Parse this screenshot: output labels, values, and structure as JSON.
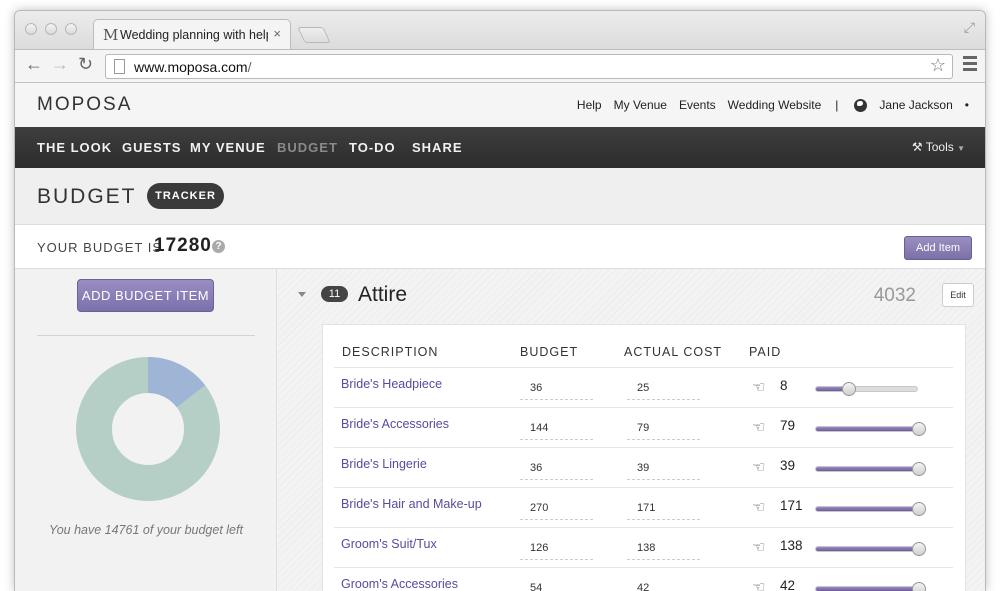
{
  "browser": {
    "tab_title": "Wedding planning with helpful",
    "tab_favicon": "M",
    "tab_close": "×",
    "url_host": "www.moposa.com",
    "url_path": "/",
    "icons": [
      "back-arrow-icon",
      "forward-arrow-icon",
      "reload-icon",
      "page-icon",
      "star-icon",
      "menu-icon",
      "close-icon",
      "resize-icon"
    ]
  },
  "header": {
    "logo": "MOPOSA",
    "links": [
      "Help",
      "My Venue",
      "Events",
      "Wedding Website"
    ],
    "separator": "|",
    "user": "Jane Jackson",
    "user_menu": "•"
  },
  "nav": {
    "items": [
      "THE LOOK",
      "GUESTS",
      "MY VENUE",
      "BUDGET",
      "TO-DO",
      "SHARE"
    ],
    "active": "BUDGET",
    "tools_label": "Tools"
  },
  "budget": {
    "title": "BUDGET",
    "tracker_label": "TRACKER",
    "your_budget_label": "YOUR BUDGET IS",
    "your_budget_value": "17280",
    "help_mark": "?",
    "add_item_label": "Add Item"
  },
  "sidebar": {
    "add_budget_item_label": "ADD BUDGET ITEM",
    "remaining_text": "You have 14761 of your budget left",
    "donut": {
      "spent_fraction": 0.146,
      "spent_color": "#9fb5d6",
      "remaining_color": "#b5cfc6"
    }
  },
  "category": {
    "count": "11",
    "title": "Attire",
    "total": "4032",
    "edit_label": "Edit",
    "columns": [
      "DESCRIPTION",
      "BUDGET",
      "ACTUAL COST",
      "PAID"
    ],
    "rows": [
      {
        "description": "Bride's Headpiece",
        "budget": "36",
        "actual": "25",
        "paid": "8",
        "paid_fraction": 0.32
      },
      {
        "description": "Bride's Accessories",
        "budget": "144",
        "actual": "79",
        "paid": "79",
        "paid_fraction": 1.0
      },
      {
        "description": "Bride's Lingerie",
        "budget": "36",
        "actual": "39",
        "paid": "39",
        "paid_fraction": 1.0
      },
      {
        "description": "Bride's Hair and Make-up",
        "budget": "270",
        "actual": "171",
        "paid": "171",
        "paid_fraction": 1.0
      },
      {
        "description": "Groom's Suit/Tux",
        "budget": "126",
        "actual": "138",
        "paid": "138",
        "paid_fraction": 1.0
      },
      {
        "description": "Groom's Accessories",
        "budget": "54",
        "actual": "42",
        "paid": "42",
        "paid_fraction": 1.0
      }
    ]
  },
  "colors": {
    "accent_purple": "#7d71ab",
    "link_purple": "#5a4a9e",
    "nav_dark": "#333333"
  }
}
